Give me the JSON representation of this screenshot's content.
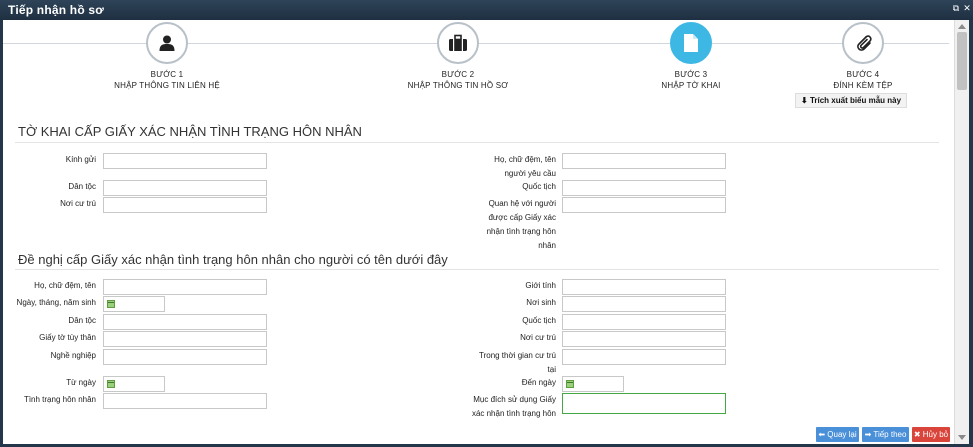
{
  "window": {
    "title": "Tiếp nhận hồ sơ"
  },
  "steps": [
    {
      "num": "BƯỚC 1",
      "name": "NHẬP THÔNG TIN LIÊN HỆ",
      "icon": "user-icon",
      "active": false
    },
    {
      "num": "BƯỚC 2",
      "name": "NHẬP THÔNG TIN HỒ SƠ",
      "icon": "briefcase-icon",
      "active": false
    },
    {
      "num": "BƯỚC 3",
      "name": "NHẬP TỜ KHAI",
      "icon": "document-icon",
      "active": true
    },
    {
      "num": "BƯỚC 4",
      "name": "ĐÍNH KÈM TỆP",
      "icon": "paperclip-icon",
      "active": false
    }
  ],
  "export_button": "Trích xuất biểu mẫu này",
  "form": {
    "title": "TỜ KHAI CẤP GIẤY XÁC NHẬN TÌNH TRẠNG HÔN NHÂN",
    "section1": {
      "left": [
        "Kính gửi",
        "Dân tộc",
        "Nơi cư trú"
      ],
      "right": [
        "Họ, chữ đệm, tên người yêu cầu",
        "Quốc tịch",
        "Quan hệ với người được cấp Giấy xác nhận tình trạng hôn nhân"
      ]
    },
    "section2_title": "Đề nghị cấp Giấy xác nhận tình trạng hôn nhân cho người có tên dưới đây",
    "section2": {
      "left": [
        "Họ, chữ đệm, tên",
        "Ngày, tháng, năm sinh",
        "Dân tộc",
        "Giấy tờ tùy thân",
        "Nghề nghiệp",
        "Từ ngày",
        "Tình trạng hôn nhân"
      ],
      "right": [
        "Giới tính",
        "Nơi sinh",
        "Quốc tịch",
        "Nơi cư trú",
        "Trong thời gian cư trú tại",
        "Đến ngày",
        "Mục đích sử dụng Giấy xác nhận tình trạng hôn"
      ]
    }
  },
  "footer": {
    "back": "Quay lại",
    "next": "Tiếp theo",
    "cancel": "Hủy bỏ"
  },
  "colors": {
    "accent": "#3db8e4",
    "back": "#4a90d9",
    "next": "#4a90d9",
    "cancel": "#d9453b"
  }
}
